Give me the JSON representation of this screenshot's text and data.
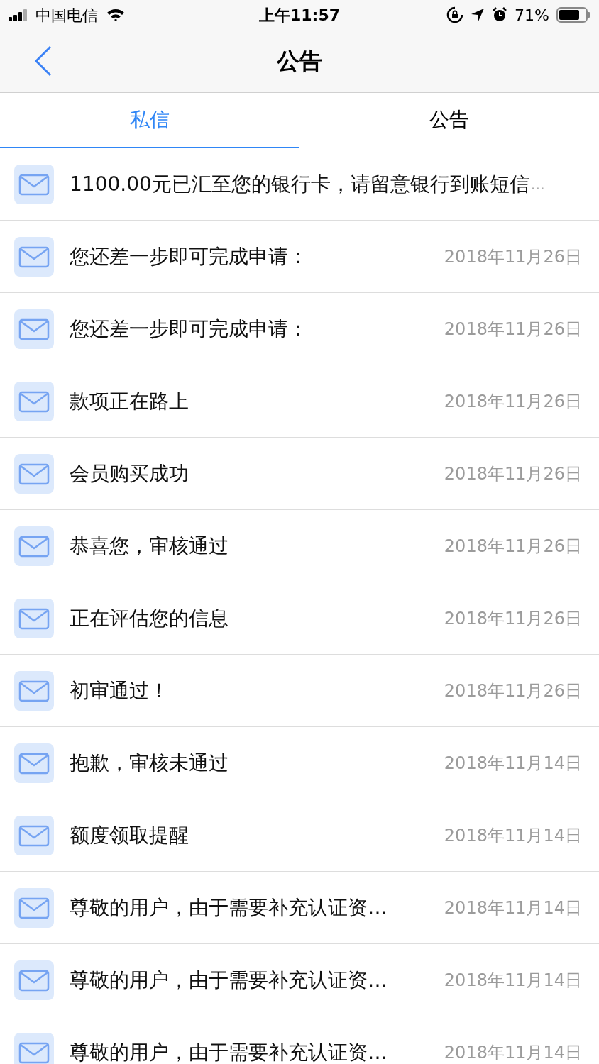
{
  "status_bar": {
    "carrier": "中国电信",
    "time": "上午11:57",
    "battery": "71%"
  },
  "nav": {
    "title": "公告"
  },
  "tabs": [
    {
      "label": "私信",
      "selected": true
    },
    {
      "label": "公告",
      "selected": false
    }
  ],
  "messages": [
    {
      "title": "1100.00元已汇至您的银行卡，请留意银行到账短信",
      "overflow_mark": "…"
    },
    {
      "title": "您还差一步即可完成申请：",
      "date": "2018年11月26日"
    },
    {
      "title": "您还差一步即可完成申请：",
      "date": "2018年11月26日"
    },
    {
      "title": "款项正在路上",
      "date": "2018年11月26日"
    },
    {
      "title": "会员购买成功",
      "date": "2018年11月26日"
    },
    {
      "title": "恭喜您，审核通过",
      "date": "2018年11月26日"
    },
    {
      "title": "正在评估您的信息",
      "date": "2018年11月26日"
    },
    {
      "title": "初审通过！",
      "date": "2018年11月26日"
    },
    {
      "title": "抱歉，审核未通过",
      "date": "2018年11月14日"
    },
    {
      "title": "额度领取提醒",
      "date": "2018年11月14日"
    },
    {
      "title": "尊敬的用户，由于需要补充认证资…",
      "date": "2018年11月14日"
    },
    {
      "title": "尊敬的用户，由于需要补充认证资…",
      "date": "2018年11月14日"
    },
    {
      "title": "尊敬的用户，由于需要补充认证资…",
      "date": "2018年11月14日"
    }
  ]
}
